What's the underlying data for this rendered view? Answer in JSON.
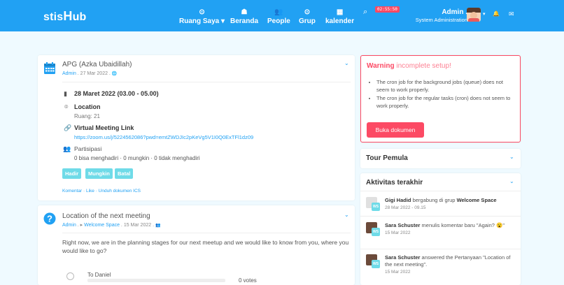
{
  "topbar": {
    "logo_part1": "stis",
    "logo_part2": "H",
    "logo_part3": "ub",
    "nav": [
      {
        "icon": "⊙",
        "label": "Ruang Saya ▾"
      },
      {
        "icon": "☗",
        "label": "Beranda"
      },
      {
        "icon": "👥",
        "label": "People"
      },
      {
        "icon": "⊙",
        "label": "Grup"
      },
      {
        "icon": "▦",
        "label": "kalender"
      }
    ],
    "search_icon": "⌕",
    "time_badge": "02:55:50",
    "user_name": "Admin .",
    "user_role": "System Administration",
    "dropdown": "▾",
    "bell": "🔔",
    "mail": "✉"
  },
  "post1": {
    "title": "APG (Azka Ubaidillah)",
    "author": "Admin",
    "date": ". 27 Mar 2022 .",
    "globe": "🌐",
    "chev": "⌄",
    "date_line": "28 Maret 2022 (03.00 - 05.00)",
    "location_label": "Location",
    "location_value": "Ruang: 21",
    "meeting_label": "Virtual Meeting Link",
    "meeting_link": "https://zoom.us/j/5224562086?pwd=emtZWDJIc2pKeVg5V1I0Q0ExTFl1dz09",
    "partisipasi_label": "Partisipasi",
    "partisipasi_value": "0 bisa menghadiri · 0 mungkin · 0 tidak menghadiri",
    "btn_hadir": "Hadir",
    "btn_mungkin": "Mungkin",
    "btn_batal": "Batal",
    "footer": "Komentar · Like · Unduh dokumen ICS"
  },
  "post2": {
    "title": "Location of the next meeting",
    "author": "Admin",
    "sep": " . ▸ ",
    "space": "Welcome Space",
    "date": " . 15 Mar 2022 .",
    "people_icon": "👥",
    "chev": "⌄",
    "body": "Right now, we are in the planning stages for our next meetup and we would like to know from you, where you would like to go?",
    "option1": "To Daniel",
    "votes1": "0 votes"
  },
  "warning": {
    "title_bold": "Warning",
    "title_rest": " incomplete setup!",
    "items": [
      "The cron job for the background jobs (queue) does not seem to work properly.",
      "The cron job for the regular tasks (cron) does not seem to work properly."
    ],
    "button": "Buka dokumen"
  },
  "tour": {
    "title": "Tour Pemula",
    "chev": "⌄"
  },
  "aktivitas": {
    "title": "Aktivitas terakhir",
    "chev": "⌄",
    "items": [
      {
        "name": "Gigi Hadid",
        "action": " bergabung di grup ",
        "target": "Welcome Space",
        "time": "28 Mar 2022 - 09.15",
        "ws": "WS"
      },
      {
        "name": "Sara Schuster",
        "action": " menulis komentar baru \"Again? 😮\"",
        "target": "",
        "time": "15 Mar 2022",
        "ws": "WS"
      },
      {
        "name": "Sara Schuster",
        "action": " answered the Pertanyaan \"Location of the next meeting\".",
        "target": "",
        "time": "15 Mar 2022",
        "ws": "WS"
      }
    ]
  }
}
